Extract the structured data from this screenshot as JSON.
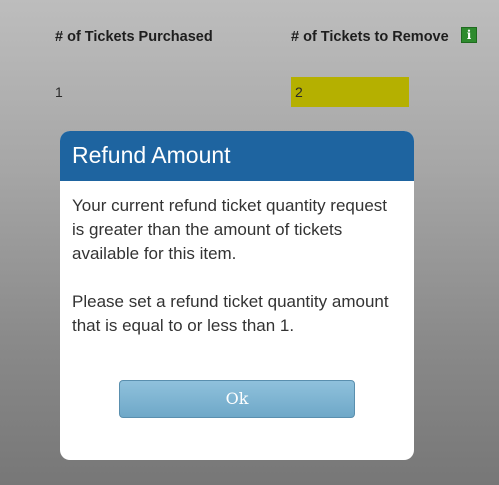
{
  "table": {
    "columns": {
      "purchased_header": "# of Tickets Purchased",
      "remove_header": "# of Tickets to Remove"
    },
    "info_icon": "info-icon",
    "rows": [
      {
        "purchased": "1",
        "remove": "2"
      }
    ],
    "highlight_color": "#b5b000"
  },
  "modal": {
    "title": "Refund Amount",
    "message1": "Your current refund ticket quantity request is greater than the amount of tickets available for this item.",
    "message2": "Please set a refund ticket quantity amount that is equal to or less than 1.",
    "ok_label": "Ok",
    "header_color": "#1e64a0"
  }
}
